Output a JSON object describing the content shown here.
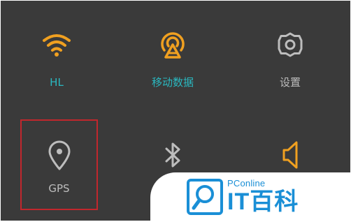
{
  "quick_settings": {
    "wifi": {
      "label": "HL",
      "icon": "wifi-icon",
      "active": true
    },
    "mobile_data": {
      "label": "移动数据",
      "icon": "mobile-data-icon",
      "active": true
    },
    "settings": {
      "label": "设置",
      "icon": "gear-icon"
    },
    "gps": {
      "label": "GPS",
      "icon": "location-pin-icon",
      "active": false,
      "highlighted": true
    },
    "bluetooth": {
      "icon": "bluetooth-icon",
      "active": false
    },
    "sound": {
      "icon": "speaker-icon",
      "active": true
    }
  },
  "watermark": {
    "subtitle": "PConline",
    "title": "IT百科"
  },
  "colors": {
    "background": "#3a3a3a",
    "active_icon": "#f0a020",
    "active_label": "#2ab8c0",
    "inactive": "#bdbdbd",
    "highlight_border": "#c1272d",
    "watermark_blue": "#1a8fd6"
  }
}
